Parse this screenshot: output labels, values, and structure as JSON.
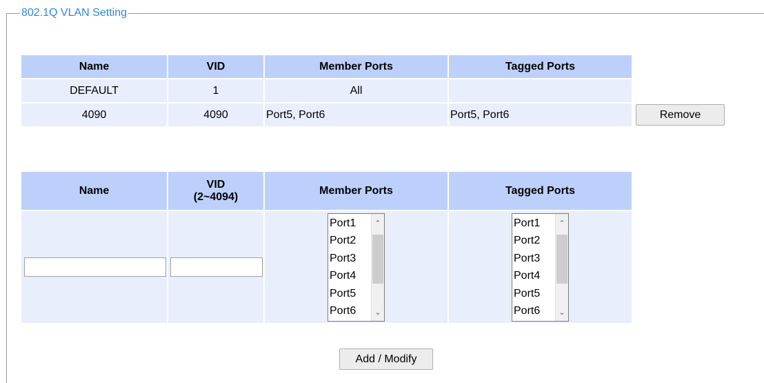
{
  "fieldset": {
    "legend": "802.1Q VLAN Setting"
  },
  "vlan_list": {
    "headers": [
      "Name",
      "VID",
      "Member Ports",
      "Tagged Ports"
    ],
    "rows": [
      {
        "name": "DEFAULT",
        "vid": "1",
        "member": "All",
        "tagged": ""
      },
      {
        "name": "4090",
        "vid": "4090",
        "member": "Port5, Port6",
        "tagged": "Port5, Port6",
        "remove_label": "Remove"
      }
    ]
  },
  "vlan_form": {
    "headers": {
      "name": "Name",
      "vid_line1": "VID",
      "vid_line2": "(2~4094)",
      "member": "Member Ports",
      "tagged": "Tagged Ports"
    },
    "name_value": "",
    "vid_value": "",
    "member_options": [
      "Port1",
      "Port2",
      "Port3",
      "Port4",
      "Port5",
      "Port6"
    ],
    "tagged_options": [
      "Port1",
      "Port2",
      "Port3",
      "Port4",
      "Port5",
      "Port6"
    ],
    "submit_label": "Add / Modify"
  },
  "icons": {
    "scroll_up": "chevron-up-icon",
    "scroll_down": "chevron-down-icon"
  }
}
